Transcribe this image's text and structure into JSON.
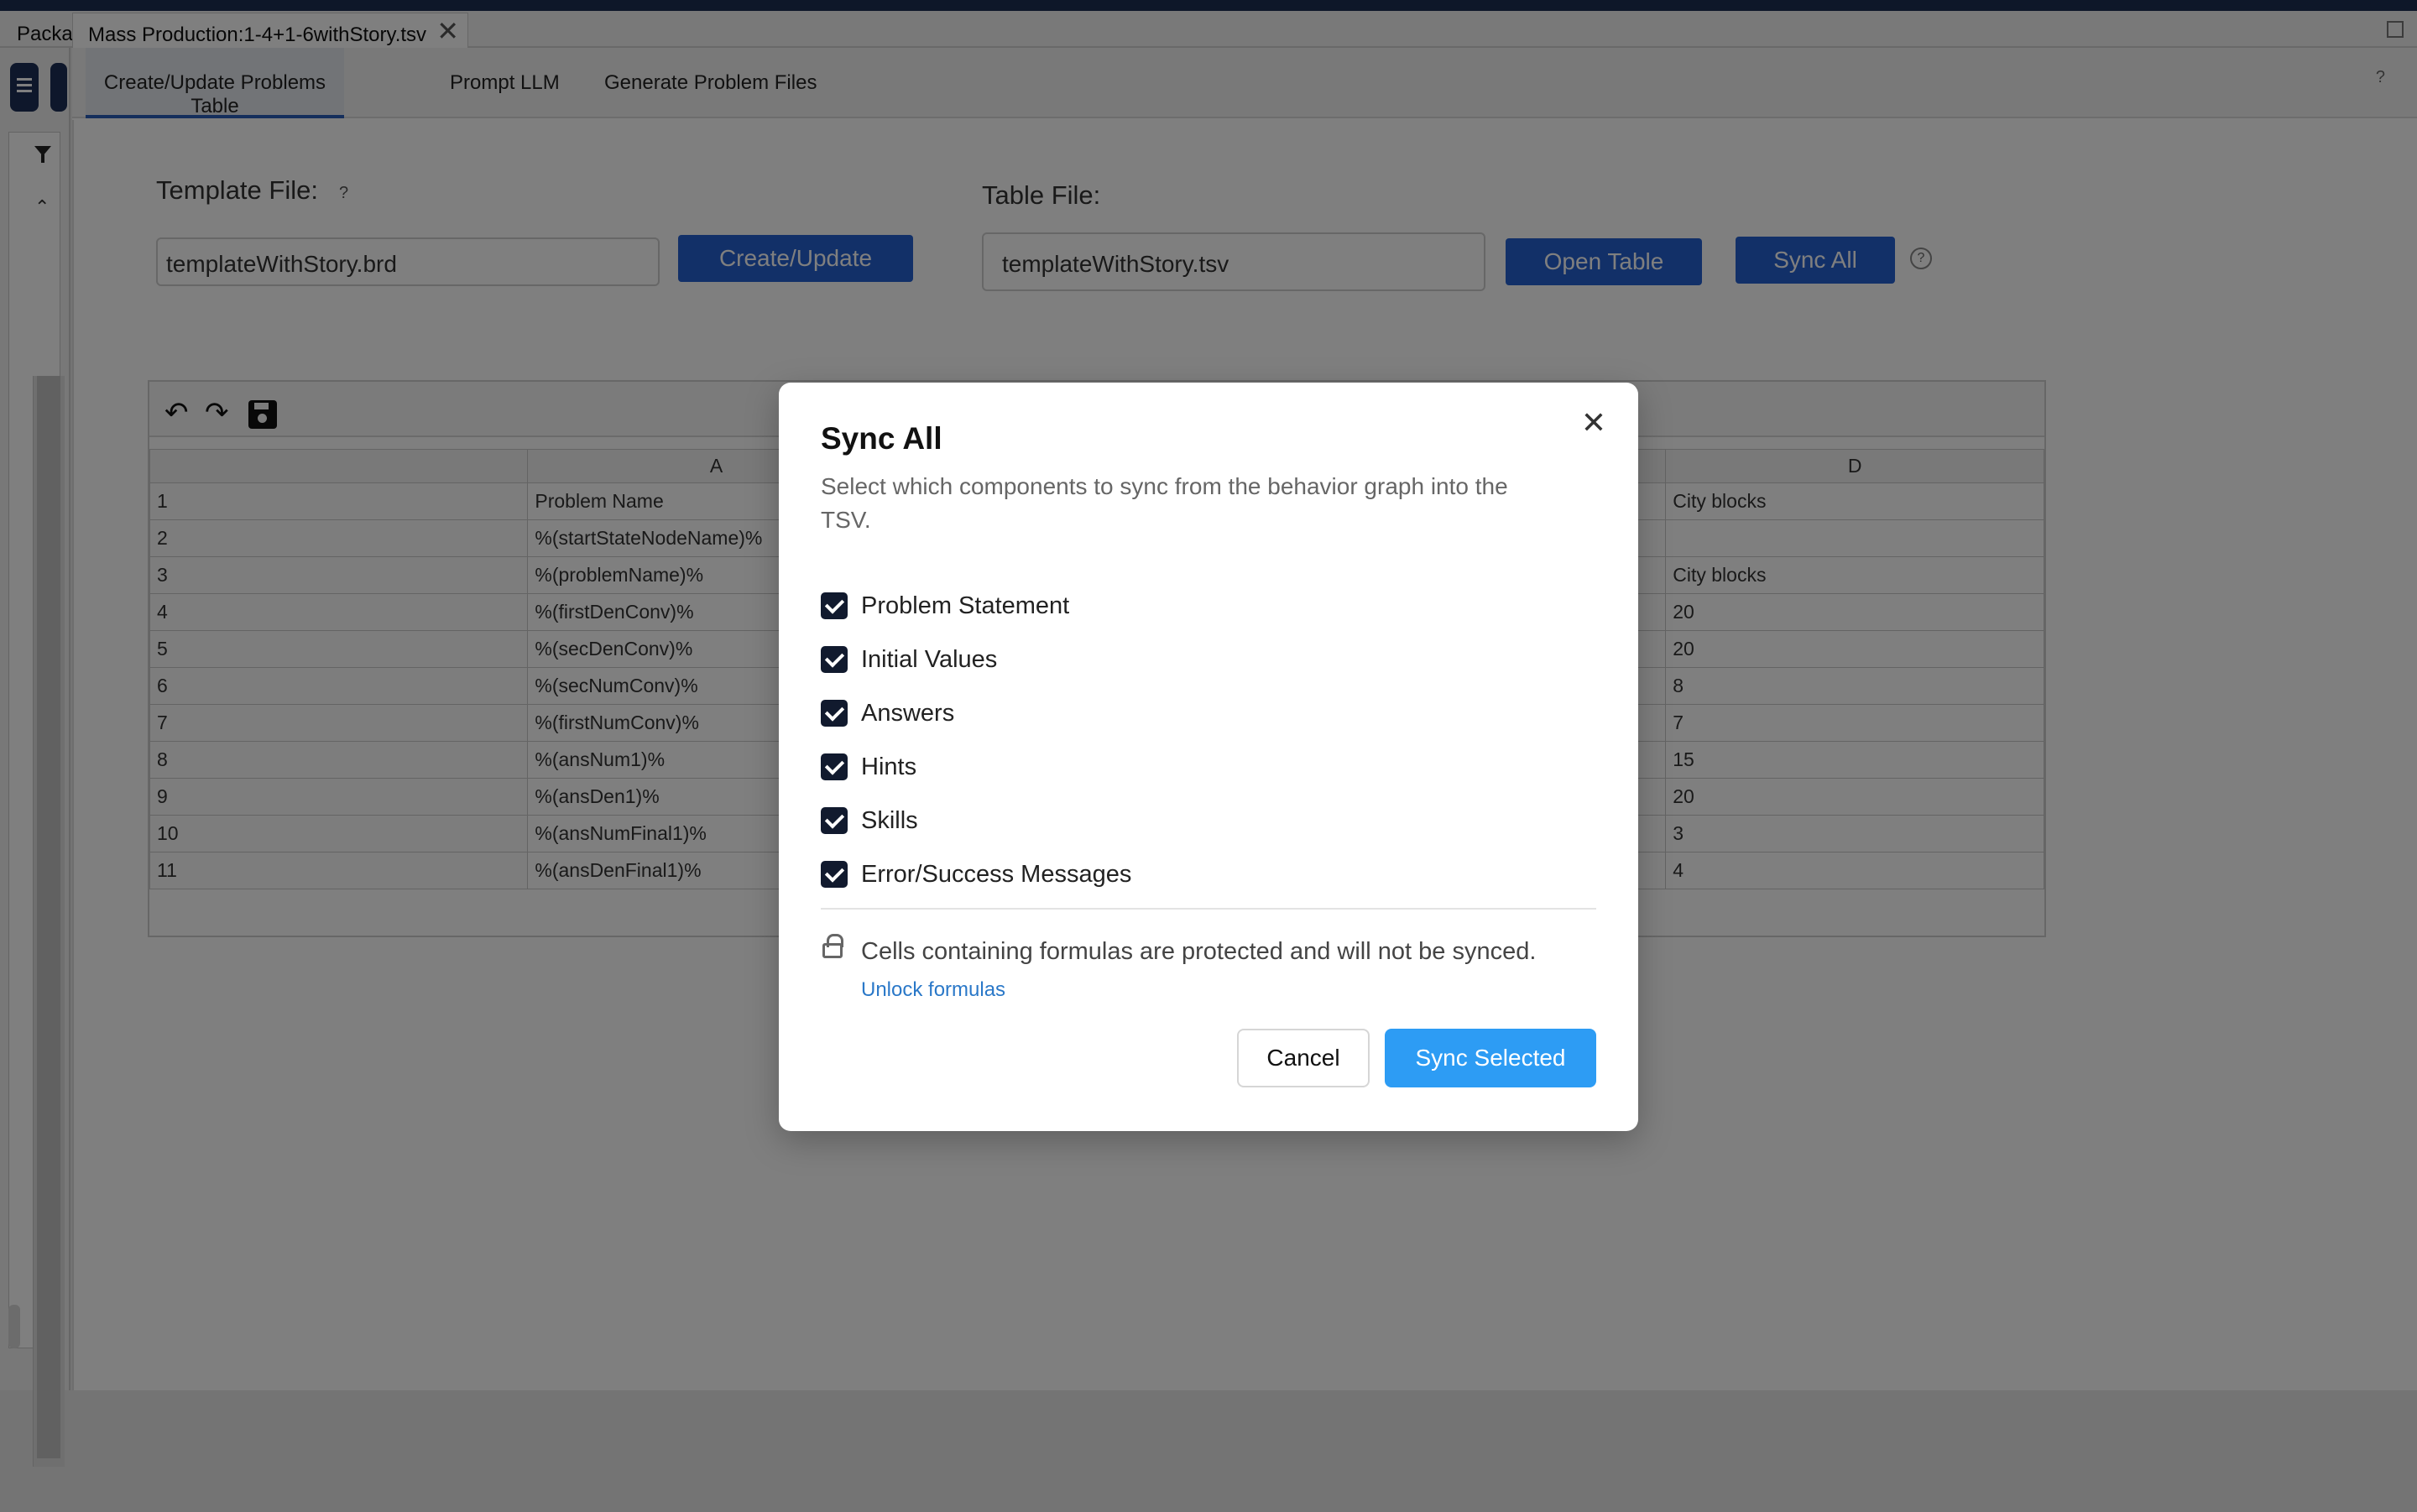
{
  "window": {
    "truncated_tab": "Packa",
    "active_tab": "Mass Production:1-4+1-6withStory.tsv",
    "close_glyph": "✕"
  },
  "main_tabs": [
    {
      "label": "Create/Update Problems Table"
    },
    {
      "label": "Prompt LLM"
    },
    {
      "label": "Generate Problem Files"
    }
  ],
  "help_glyph": "?",
  "template": {
    "label": "Template File:",
    "value": "templateWithStory.brd",
    "button": "Create/Update"
  },
  "table_file": {
    "label": "Table File:",
    "value": "templateWithStory.tsv",
    "open_button": "Open Table",
    "sync_button": "Sync All"
  },
  "sheet": {
    "columns": [
      "A",
      "D"
    ],
    "rows": [
      {
        "n": "1",
        "a": "Problem Name",
        "d": "City blocks"
      },
      {
        "n": "2",
        "a": "%(startStateNodeName)%",
        "d": ""
      },
      {
        "n": "3",
        "a": "%(problemName)%",
        "d": "City blocks"
      },
      {
        "n": "4",
        "a": "%(firstDenConv)%",
        "d": "20"
      },
      {
        "n": "5",
        "a": "%(secDenConv)%",
        "d": "20"
      },
      {
        "n": "6",
        "a": "%(secNumConv)%",
        "d": "8"
      },
      {
        "n": "7",
        "a": "%(firstNumConv)%",
        "d": "7"
      },
      {
        "n": "8",
        "a": "%(ansNum1)%",
        "d": "15"
      },
      {
        "n": "9",
        "a": "%(ansDen1)%",
        "d": "20"
      },
      {
        "n": "10",
        "a": "%(ansNumFinal1)%",
        "d": "3"
      },
      {
        "n": "11",
        "a": "%(ansDenFinal1)%",
        "d": "4"
      }
    ]
  },
  "modal": {
    "title": "Sync All",
    "close_glyph": "✕",
    "description": "Select which components to sync from the behavior graph into the TSV.",
    "options": [
      {
        "label": "Problem Statement",
        "checked": true
      },
      {
        "label": "Initial Values",
        "checked": true
      },
      {
        "label": "Answers",
        "checked": true
      },
      {
        "label": "Hints",
        "checked": true
      },
      {
        "label": "Skills",
        "checked": true
      },
      {
        "label": "Error/Success Messages",
        "checked": true
      }
    ],
    "lock_message": "Cells containing formulas are protected and will not be synced.",
    "unlock_link": "Unlock formulas",
    "cancel": "Cancel",
    "confirm": "Sync Selected"
  },
  "colors": {
    "primary_button": "#2560d1",
    "confirm_button": "#2d9cf4",
    "link": "#2a78c8",
    "checkbox": "#111a2e"
  }
}
